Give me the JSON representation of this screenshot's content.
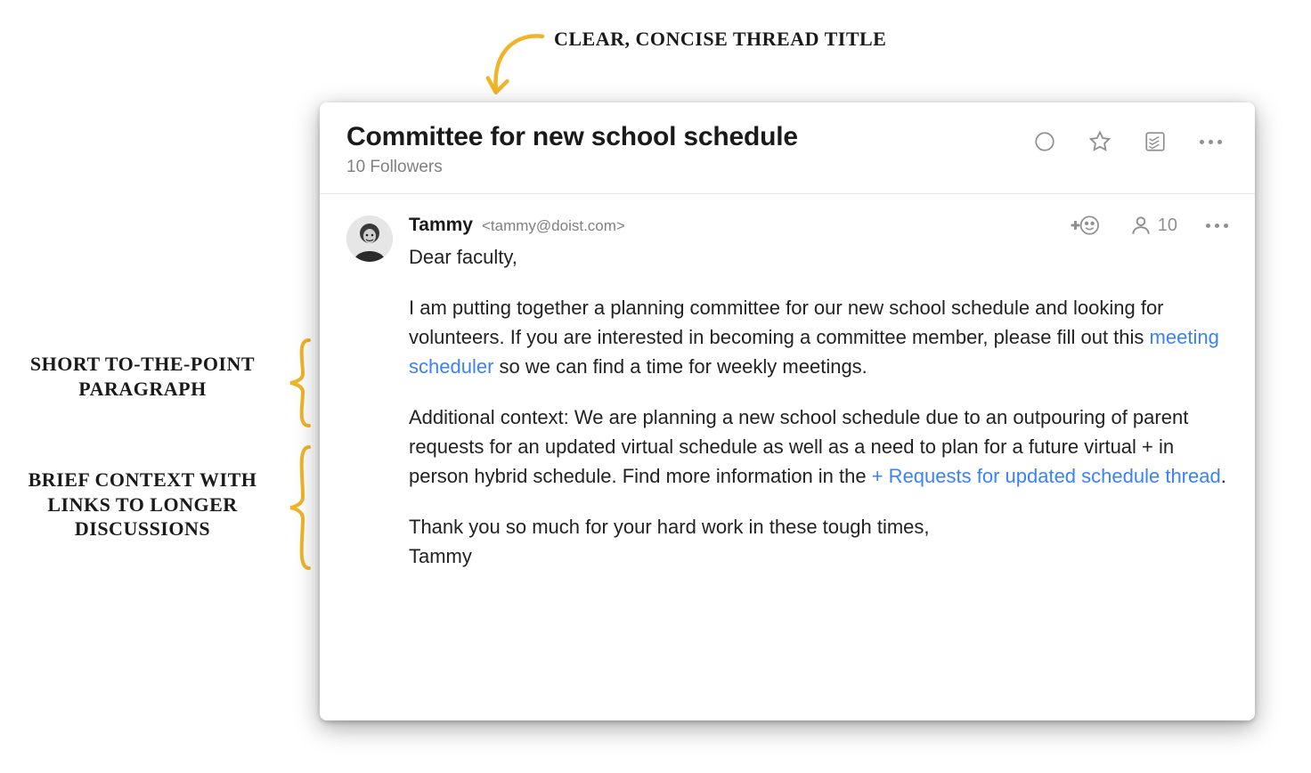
{
  "annotations": {
    "top": "Clear, concise thread title",
    "mid": "Short to-the-point paragraph",
    "bot": "Brief context with links to longer discussions"
  },
  "thread": {
    "title": "Committee for new school schedule",
    "followers": "10 Followers"
  },
  "post": {
    "author_name": "Tammy",
    "author_email": "<tammy@doist.com>",
    "people_count": "10",
    "greeting": "Dear faculty,",
    "p1_pre": "I am putting together a planning committee for our new school schedule and looking for volunteers. If you are interested in becoming a committee member, please fill out this ",
    "link1": "meeting scheduler",
    "p1_post": " so we can find a time for weekly meetings.",
    "p2_pre": "Additional context: We are planning a new school schedule due to an outpouring of parent requests for an updated virtual schedule as well as a need to plan for a future virtual + in person hybrid schedule. Find more information in the ",
    "link2": "+ Requests for updated schedule thread",
    "p2_post": ".",
    "thanks": "Thank you so much for your hard work in these tough times,",
    "signature": "Tammy"
  }
}
